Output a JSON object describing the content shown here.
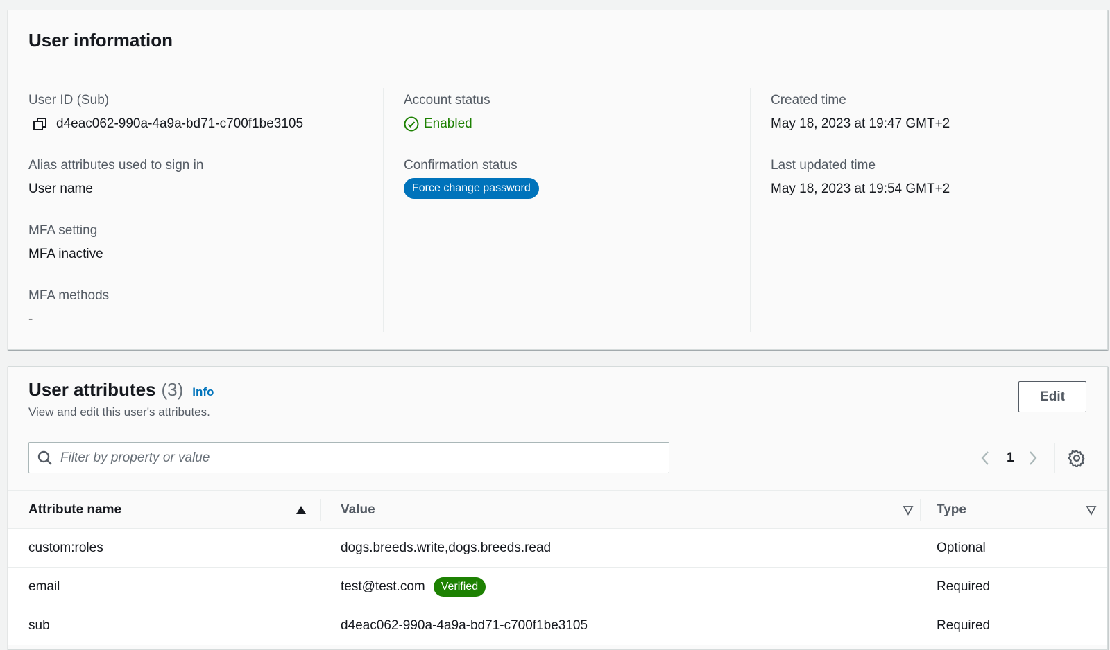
{
  "user_info": {
    "title": "User information",
    "user_id_label": "User ID (Sub)",
    "user_id_value": "d4eac062-990a-4a9a-bd71-c700f1be3105",
    "alias_label": "Alias attributes used to sign in",
    "alias_value": "User name",
    "mfa_setting_label": "MFA setting",
    "mfa_setting_value": "MFA inactive",
    "mfa_methods_label": "MFA methods",
    "mfa_methods_value": "-",
    "account_status_label": "Account status",
    "account_status_value": "Enabled",
    "confirmation_status_label": "Confirmation status",
    "confirmation_status_value": "Force change password",
    "created_time_label": "Created time",
    "created_time_value": "May 18, 2023 at 19:47 GMT+2",
    "last_updated_label": "Last updated time",
    "last_updated_value": "May 18, 2023 at 19:54 GMT+2"
  },
  "user_attributes": {
    "title": "User attributes",
    "count": "(3)",
    "info_link": "Info",
    "description": "View and edit this user's attributes.",
    "edit_label": "Edit",
    "filter_placeholder": "Filter by property or value",
    "page": "1",
    "columns": {
      "name": "Attribute name",
      "value": "Value",
      "type": "Type"
    },
    "rows": [
      {
        "name": "custom:roles",
        "value": "dogs.breeds.write,dogs.breeds.read",
        "badge": "",
        "type": "Optional"
      },
      {
        "name": "email",
        "value": "test@test.com",
        "badge": "Verified",
        "type": "Required"
      },
      {
        "name": "sub",
        "value": "d4eac062-990a-4a9a-bd71-c700f1be3105",
        "badge": "",
        "type": "Required"
      }
    ]
  },
  "colors": {
    "success": "#1d8102",
    "info_blue": "#0073bb",
    "text": "#16191f",
    "label": "#545b64"
  },
  "icons": [
    "copy-icon",
    "check-circle-icon",
    "search-icon",
    "chevron-left-icon",
    "chevron-right-icon",
    "settings-gear-icon",
    "sort-ascending-icon",
    "sort-descending-icon"
  ]
}
